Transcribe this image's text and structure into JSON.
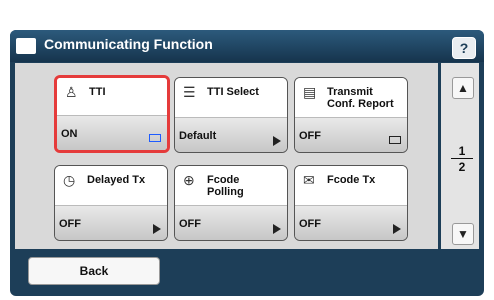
{
  "window": {
    "title": "Communicating Function",
    "help_label": "?"
  },
  "tiles": [
    {
      "label": "TTI",
      "value": "ON",
      "icon": "person-stand-icon"
    },
    {
      "label": "TTI Select",
      "value": "Default",
      "icon": "list-person-icon"
    },
    {
      "label": "Transmit\nConf. Report",
      "value": "OFF",
      "icon": "report-icon"
    },
    {
      "label": "Delayed Tx",
      "value": "OFF",
      "icon": "clock-icon"
    },
    {
      "label": "Fcode\nPolling",
      "value": "OFF",
      "icon": "polling-icon"
    },
    {
      "label": "Fcode Tx",
      "value": "OFF",
      "icon": "envelope-icon"
    }
  ],
  "pagination": {
    "current": "1",
    "total": "2"
  },
  "back_label": "Back"
}
